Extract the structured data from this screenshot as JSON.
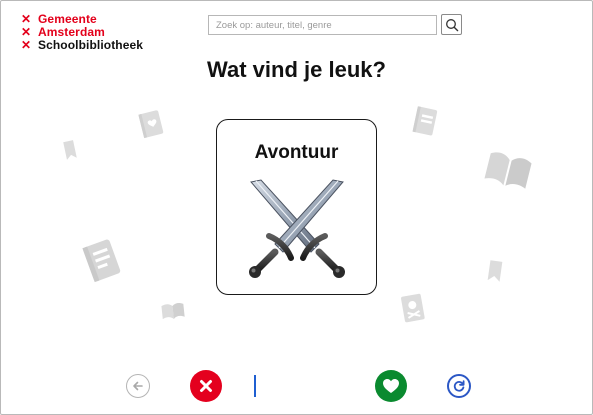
{
  "logo": {
    "line1": "Gemeente",
    "line2": "Amsterdam",
    "line3": "Schoolbibliotheek",
    "mark": "✕"
  },
  "search": {
    "placeholder": "Zoek op: auteur, titel, genre",
    "value": "",
    "icon": "search-icon"
  },
  "page": {
    "title": "Wat vind je leuk?"
  },
  "card": {
    "label": "Avontuur",
    "image": "crossed-swords"
  },
  "controls": {
    "back": "arrow-left-icon",
    "dislike": "close-icon",
    "like": "heart-icon",
    "refresh": "refresh-icon"
  },
  "colors": {
    "brand_red": "#e3001b",
    "dislike_red": "#e4001e",
    "like_green": "#0a8a2f",
    "refresh_blue": "#2b57c5",
    "deco_gray": "#d9d9d9"
  }
}
